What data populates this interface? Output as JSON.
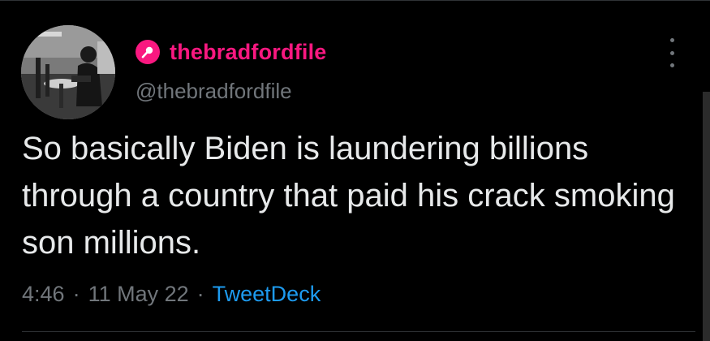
{
  "tweet": {
    "display_name": "thebradfordfile",
    "handle": "@thebradfordfile",
    "text": "So basically Biden is laundering billions through a country that paid his crack smoking son millions.",
    "time": "4:46",
    "date": "11 May 22",
    "separator": "·",
    "source": "TweetDeck"
  },
  "icons": {
    "badge": "microphone-icon",
    "more": "more-vertical-icon",
    "avatar": "avatar-photo"
  },
  "colors": {
    "background": "#000000",
    "display_name": "#f91880",
    "secondary_text": "#71767b",
    "main_text": "#e7e9ea",
    "link": "#1d9bf0"
  }
}
